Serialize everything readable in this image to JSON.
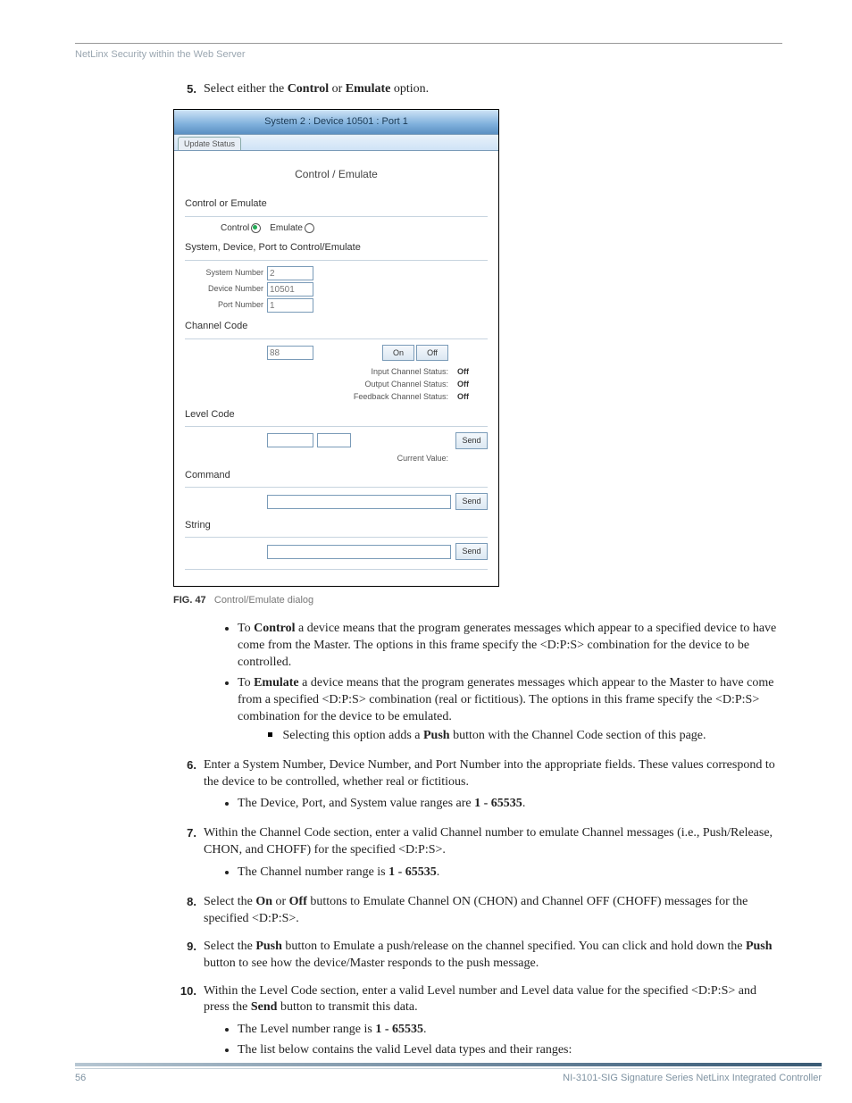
{
  "header": {
    "breadcrumb": "NetLinx Security within the Web Server"
  },
  "steps": {
    "s5": {
      "num": "5.",
      "text_a": "Select either the ",
      "text_b": "Control",
      "text_c": " or ",
      "text_d": "Emulate",
      "text_e": " option."
    },
    "s6": {
      "num": "6.",
      "text": "Enter a System Number, Device Number, and Port Number into the appropriate fields. These values correspond to the device to be controlled, whether real or fictitious.",
      "sub1_a": "The Device, Port, and System value ranges are ",
      "sub1_b": "1 - 65535",
      "sub1_c": "."
    },
    "s7": {
      "num": "7.",
      "text": "Within the Channel Code section, enter a valid Channel number to emulate Channel messages (i.e., Push/Release, CHON, and CHOFF) for the specified <D:P:S>.",
      "sub1_a": "The Channel number range is ",
      "sub1_b": "1 - 65535",
      "sub1_c": "."
    },
    "s8": {
      "num": "8.",
      "text_a": "Select the ",
      "text_b": "On",
      "text_c": " or ",
      "text_d": "Off",
      "text_e": " buttons to Emulate Channel ON (CHON) and Channel OFF (CHOFF) messages for the specified <D:P:S>."
    },
    "s9": {
      "num": "9.",
      "text_a": "Select the ",
      "text_b": "Push",
      "text_c": " button to Emulate a push/release on the channel specified. You can click and hold down the ",
      "text_d": "Push",
      "text_e": " button to see how the device/Master responds to the push message."
    },
    "s10": {
      "num": "10.",
      "text_a": "Within the Level Code section, enter a valid Level number and Level data value for the specified <D:P:S> and press the ",
      "text_b": "Send",
      "text_c": " button to transmit this data.",
      "sub1_a": "The Level number range is ",
      "sub1_b": "1 - 65535",
      "sub1_c": ".",
      "sub2": "The list below contains the valid Level data types and their ranges:"
    }
  },
  "bullets_after_fig": {
    "b1_a": "To ",
    "b1_b": "Control",
    "b1_c": " a device means that the program generates messages which appear to a specified device to have come from the Master. The options in this frame specify the <D:P:S> combination for the device to be controlled.",
    "b2_a": "To ",
    "b2_b": "Emulate",
    "b2_c": " a device means that the program generates messages which appear to the Master to have come from a specified <D:P:S> combination (real or fictitious). The options in this frame specify the <D:P:S> combination for the device to be emulated.",
    "b2_sub_a": "Selecting this option adds a ",
    "b2_sub_b": "Push",
    "b2_sub_c": " button with the Channel Code section of this page."
  },
  "figcaption": {
    "label": "FIG. 47",
    "text": "Control/Emulate dialog"
  },
  "panel": {
    "title": "System 2 : Device 10501 : Port 1",
    "tab": "Update Status",
    "heading": "Control / Emulate",
    "sec_mode": "Control or Emulate",
    "mode_control": "Control",
    "mode_emulate": "Emulate",
    "sec_sdp": "System, Device, Port to Control/Emulate",
    "lbl_system": "System Number",
    "val_system": "2",
    "lbl_device": "Device Number",
    "val_device": "10501",
    "lbl_port": "Port Number",
    "val_port": "1",
    "sec_channel": "Channel Code",
    "val_channel": "88",
    "btn_on": "On",
    "btn_off": "Off",
    "lbl_input_status": "Input Channel Status:",
    "val_input_status": "Off",
    "lbl_output_status": "Output Channel Status:",
    "val_output_status": "Off",
    "lbl_feedback_status": "Feedback Channel Status:",
    "val_feedback_status": "Off",
    "sec_level": "Level Code",
    "btn_send_level": "Send",
    "lbl_current_value": "Current Value:",
    "sec_command": "Command",
    "btn_send_command": "Send",
    "sec_string": "String",
    "btn_send_string": "Send"
  },
  "footer": {
    "page": "56",
    "doc": "NI-3101-SIG Signature Series NetLinx Integrated Controller"
  }
}
